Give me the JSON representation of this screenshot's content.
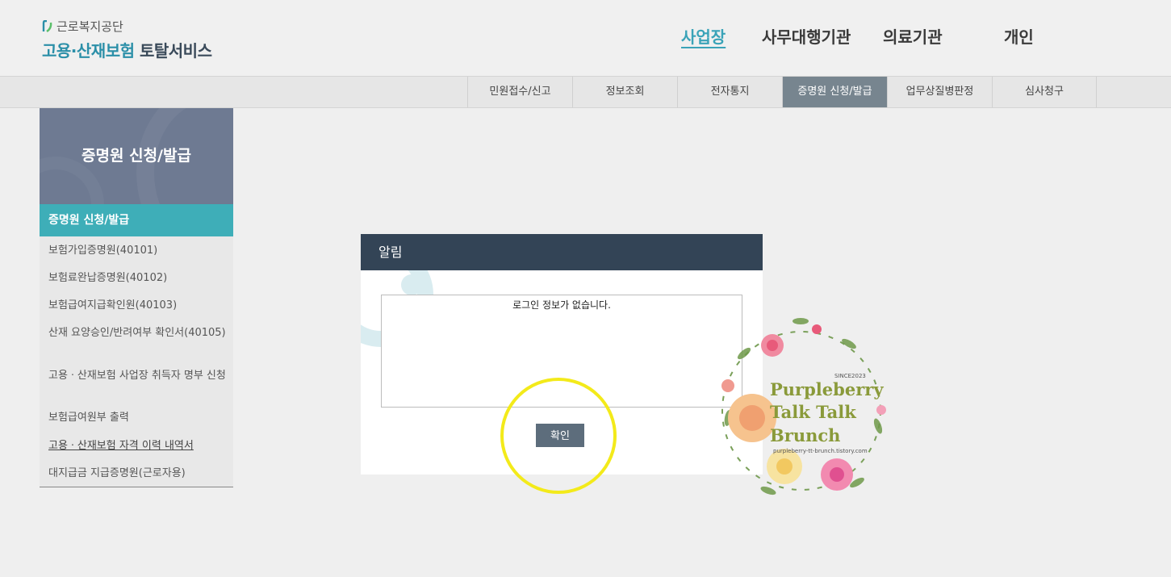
{
  "header": {
    "org_name": "근로복지공단",
    "service_name_part1": "고용·산재보험",
    "service_name_part2": "토탈서비스",
    "nav": [
      {
        "label": "사업장",
        "active": true
      },
      {
        "label": "사무대행기관",
        "active": false
      },
      {
        "label": "의료기관",
        "active": false
      },
      {
        "label": "개인",
        "active": false
      }
    ]
  },
  "subnav": {
    "tabs": [
      {
        "label": "민원접수/신고",
        "active": false
      },
      {
        "label": "정보조회",
        "active": false
      },
      {
        "label": "전자통지",
        "active": false
      },
      {
        "label": "증명원 신청/발급",
        "active": true
      },
      {
        "label": "업무상질병판정",
        "active": false
      },
      {
        "label": "심사청구",
        "active": false
      }
    ]
  },
  "sidebar": {
    "title": "증명원 신청/발급",
    "section": "증명원 신청/발급",
    "items": [
      {
        "label": "보험가입증명원(40101)"
      },
      {
        "label": "보험료완납증명원(40102)"
      },
      {
        "label": "보험급여지급확인원(40103)"
      },
      {
        "label": "산재 요양승인/반려여부 확인서(40105)"
      },
      {
        "label": "고용ㆍ산재보험 사업장 취득자 명부 신청"
      },
      {
        "label": "보험급여원부 출력"
      },
      {
        "label": "고용ㆍ산재보험 자격 이력 내역서",
        "current": true
      },
      {
        "label": "대지급금 지급증명원(근로자용)"
      }
    ]
  },
  "dialog": {
    "title": "알림",
    "message": "로그인 정보가 없습니다.",
    "ok_label": "확인"
  },
  "watermark": {
    "since": "SINCE2023",
    "line1": "Purpleberry",
    "line2": "Talk Talk",
    "line3": "Brunch",
    "url": "purpleberry-tt-brunch.tistory.com"
  },
  "colors": {
    "accent": "#3aa3b8",
    "dialog_header": "#334456",
    "highlight": "#f3ea1a",
    "sidebar_header": "#6e7a92",
    "sidebar_active": "#3eaeb8"
  }
}
